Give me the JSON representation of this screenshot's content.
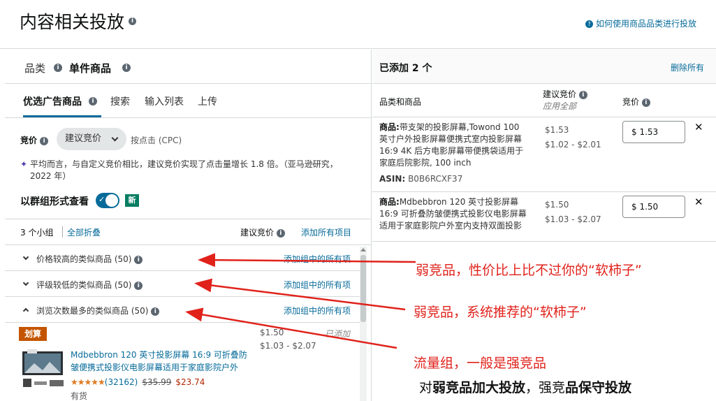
{
  "header": {
    "title": "内容相关投放",
    "help_link": "如何使用商品品类进行投放"
  },
  "left": {
    "cat_tabs": [
      "品类",
      "单件商品"
    ],
    "sub_tabs": [
      "优选广告商品",
      "搜索",
      "输入列表",
      "上传"
    ],
    "bid": {
      "label": "竞价",
      "select_value": "建议竞价",
      "note": "按点击 (CPC)"
    },
    "stat_text": "平均而言，与自定义竞价相比，建议竞价实现了点击量增长 1.8 倍。（亚马逊研究，2022 年）",
    "group_view": {
      "label": "以群组形式查看",
      "badge": "新"
    },
    "groups_header": {
      "count": "3 个小组",
      "collapse": "全部折叠",
      "suggested": "建议竞价",
      "add_all": "添加所有项目"
    },
    "groups": [
      {
        "label": "价格较高的类似商品 (50)",
        "add": "添加组中的所有项"
      },
      {
        "label": "评级较低的类似商品 (50)",
        "add": "添加组中的所有项"
      },
      {
        "label": "浏览次数最多的类似商品 (50)",
        "add": "添加组中的所有项"
      }
    ],
    "product": {
      "badge": "划算",
      "price": "$1.50",
      "range": "$1.03 - $2.07",
      "status": "已添加",
      "title": "Mdbebbron 120 英寸投影屏幕 16:9 可折叠防皱便携式投影仪电影屏幕适用于家庭影院户外",
      "stars": "★★★★★",
      "reviews": "(32162)",
      "old_price": "$35.99",
      "new_price": "$23.74",
      "stock": "有货"
    }
  },
  "right": {
    "count": "已添加 2 个",
    "remove_all": "删除所有",
    "cols": {
      "product": "品类和商品",
      "suggested": "建议竞价",
      "apply_all": "应用全部",
      "bid": "竞价"
    },
    "items": [
      {
        "prefix": "商品:",
        "title": "带支架的投影屏幕,Towond 100 英寸户外投影屏幕便携式室内投影屏幕 16:9 4K 后方电影屏幕带便携袋适用于家庭后院影院, 100 inch",
        "asin_label": "ASIN:",
        "asin": "B0B6RCXF37",
        "suggested": "$1.53",
        "range": "$1.02 - $2.01",
        "bid": "$ 1.53"
      },
      {
        "prefix": "商品:",
        "title": "Mdbebbron 120 英寸投影屏幕 16:9 可折叠防皱便携式投影仪电影屏幕适用于家庭影院户外室内支持双面投影",
        "suggested": "$1.50",
        "range": "$1.03 - $2.07",
        "bid": "$ 1.50"
      }
    ]
  },
  "annotations": {
    "a1": "弱竞品，性价比上比不过你的“软柿子”",
    "a2": "弱竞品，系统推荐的“软柿子”",
    "a3": "流量组，一般是强竞品",
    "a4_part1": "对",
    "a4_part2": "弱竞品加大投放",
    "a4_part3": "，强竞",
    "a4_part4": "品保守投放"
  },
  "colors": {
    "link": "#076b9a",
    "annotation": "#e0221b",
    "deal_badge": "#c45500"
  }
}
